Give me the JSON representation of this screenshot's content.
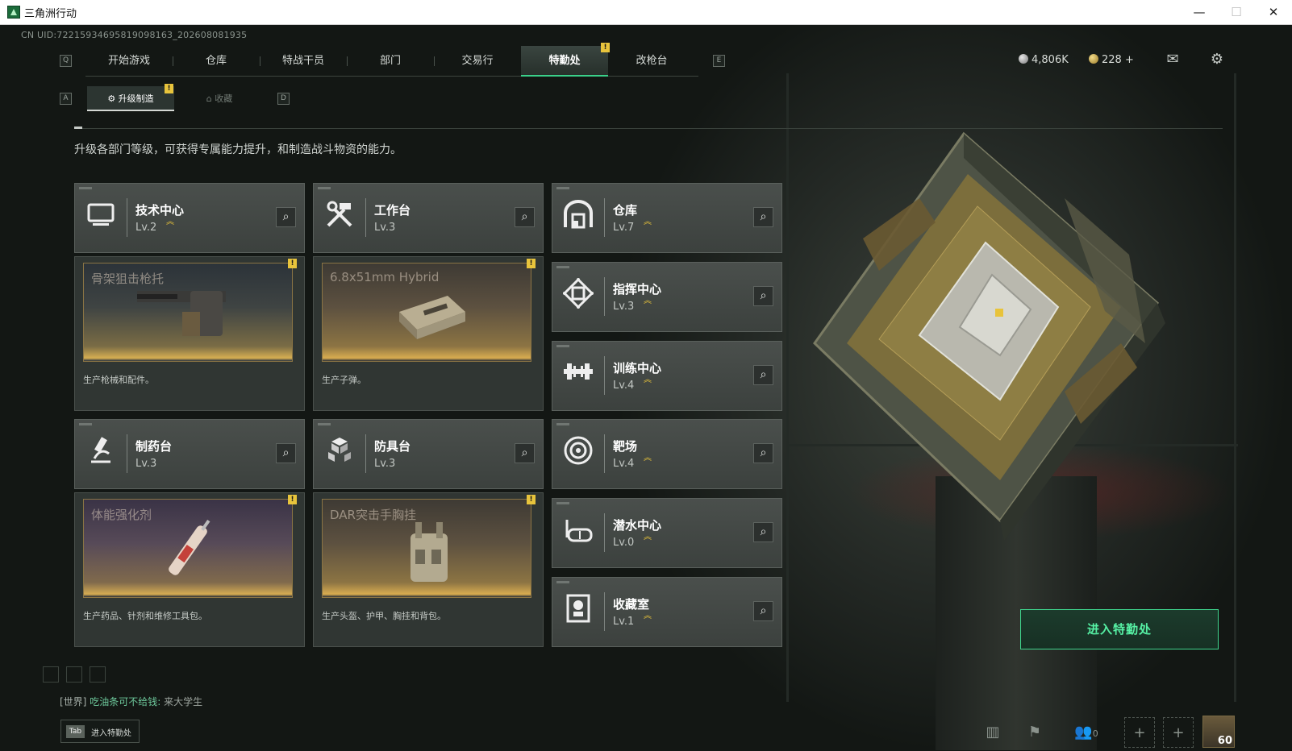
{
  "window": {
    "title": "三角洲行动",
    "minimize": "—",
    "maximize": "☐",
    "close": "✕"
  },
  "uid": "CN UID:7221593469581909816​3_202608081935",
  "nav": {
    "left_key": "Q",
    "right_key": "E",
    "tabs": [
      {
        "label": "开始游戏"
      },
      {
        "label": "仓库"
      },
      {
        "label": "特战干员"
      },
      {
        "label": "部门"
      },
      {
        "label": "交易行"
      },
      {
        "label": "特勤处",
        "active": true,
        "badge": "!"
      },
      {
        "label": "改枪台"
      }
    ]
  },
  "resources": {
    "silver": "4,806K",
    "gold": "228",
    "gold_add": "+"
  },
  "subtabs": {
    "left_key": "A",
    "right_key": "D",
    "items": [
      {
        "label": "升级制造",
        "active": true,
        "badge": "!"
      },
      {
        "label": "收藏",
        "active": false
      }
    ]
  },
  "description": "升级各部门等级，可获得专属能力提升，和制造战斗物资的能力。",
  "departments": [
    {
      "name": "技术中心",
      "level": "Lv.2",
      "upgradable": true,
      "icon": "monitor-icon"
    },
    {
      "name": "工作台",
      "level": "Lv.3",
      "upgradable": false,
      "icon": "tools-icon"
    },
    {
      "name": "仓库",
      "level": "Lv.7",
      "upgradable": true,
      "icon": "warehouse-icon"
    },
    {
      "name": "指挥中心",
      "level": "Lv.3",
      "upgradable": true,
      "icon": "command-icon"
    },
    {
      "name": "训练中心",
      "level": "Lv.4",
      "upgradable": true,
      "icon": "dumbbell-icon"
    },
    {
      "name": "制药台",
      "level": "Lv.3",
      "upgradable": false,
      "icon": "microscope-icon"
    },
    {
      "name": "防具台",
      "level": "Lv.3",
      "upgradable": false,
      "icon": "armor-blocks-icon"
    },
    {
      "name": "靶场",
      "level": "Lv.4",
      "upgradable": true,
      "icon": "target-icon"
    },
    {
      "name": "潜水中心",
      "level": "Lv.0",
      "upgradable": true,
      "icon": "dive-mask-icon"
    },
    {
      "name": "收藏室",
      "level": "Lv.1",
      "upgradable": true,
      "icon": "collection-icon"
    }
  ],
  "productions": [
    {
      "item": "骨架狙击枪托",
      "caption": "生产枪械和配件。",
      "badge": "!"
    },
    {
      "item": "6.8x51mm Hybrid",
      "caption": "生产子弹。",
      "badge": "!"
    },
    {
      "item": "体能强化剂",
      "caption": "生产药品、针剂和维修工具包。",
      "badge": "!"
    },
    {
      "item": "DAR突击手胸挂",
      "caption": "生产头盔、护甲、胸挂和背包。",
      "badge": "!"
    }
  ],
  "enter_button": "进入特勤处",
  "chat": {
    "channel": "[世界]",
    "user": "吃油条可不给钱:",
    "message": "来大学生"
  },
  "tab_hint": {
    "key": "Tab",
    "label": "进入特勤处"
  },
  "bottom_bar": {
    "friends_count": "0",
    "player_level": "60"
  },
  "colors": {
    "accent_green": "#3fd68e",
    "upgrade_gold": "#e8c33a",
    "badge_yellow": "#e8c43c"
  }
}
